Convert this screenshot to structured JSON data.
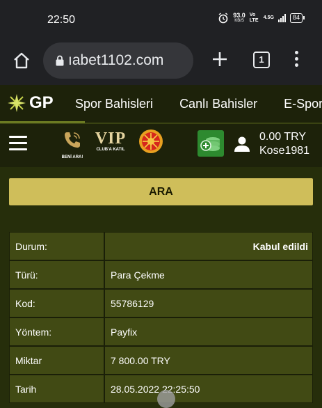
{
  "status_bar": {
    "time": "22:50",
    "net_speed": "93.0",
    "net_unit": "KB/S",
    "volte": "Vo LTE",
    "network": "4.5G",
    "battery": "84"
  },
  "browser": {
    "url": "ıabet1102.com",
    "tab_count": "1"
  },
  "site_nav": {
    "logo_text": "GP",
    "links": [
      "Spor Bahisleri",
      "Canlı Bahisler",
      "E-Spor"
    ]
  },
  "user_bar": {
    "beniara_label": "BENİ ARA!",
    "vip_text": "VIP",
    "vip_label": "CLUB'A KATIL",
    "balance": "0.00 TRY",
    "username": "Kose1981"
  },
  "search": {
    "button_label": "ARA"
  },
  "details": {
    "rows": [
      {
        "label": "Durum:",
        "value": "Kabul edildi"
      },
      {
        "label": "Türü:",
        "value": "Para Çekme"
      },
      {
        "label": "Kod:",
        "value": "55786129"
      },
      {
        "label": "Yöntem:",
        "value": "Payfix"
      },
      {
        "label": "Miktar",
        "value": "7 800.00 TRY"
      },
      {
        "label": "Tarih",
        "value": "28.05.2022 22:25:50"
      }
    ]
  },
  "colors": {
    "background": "#262e0b",
    "accent_button": "#cfbe5a",
    "table_cell": "#414a14",
    "deposit_green": "#2d8a2f"
  }
}
